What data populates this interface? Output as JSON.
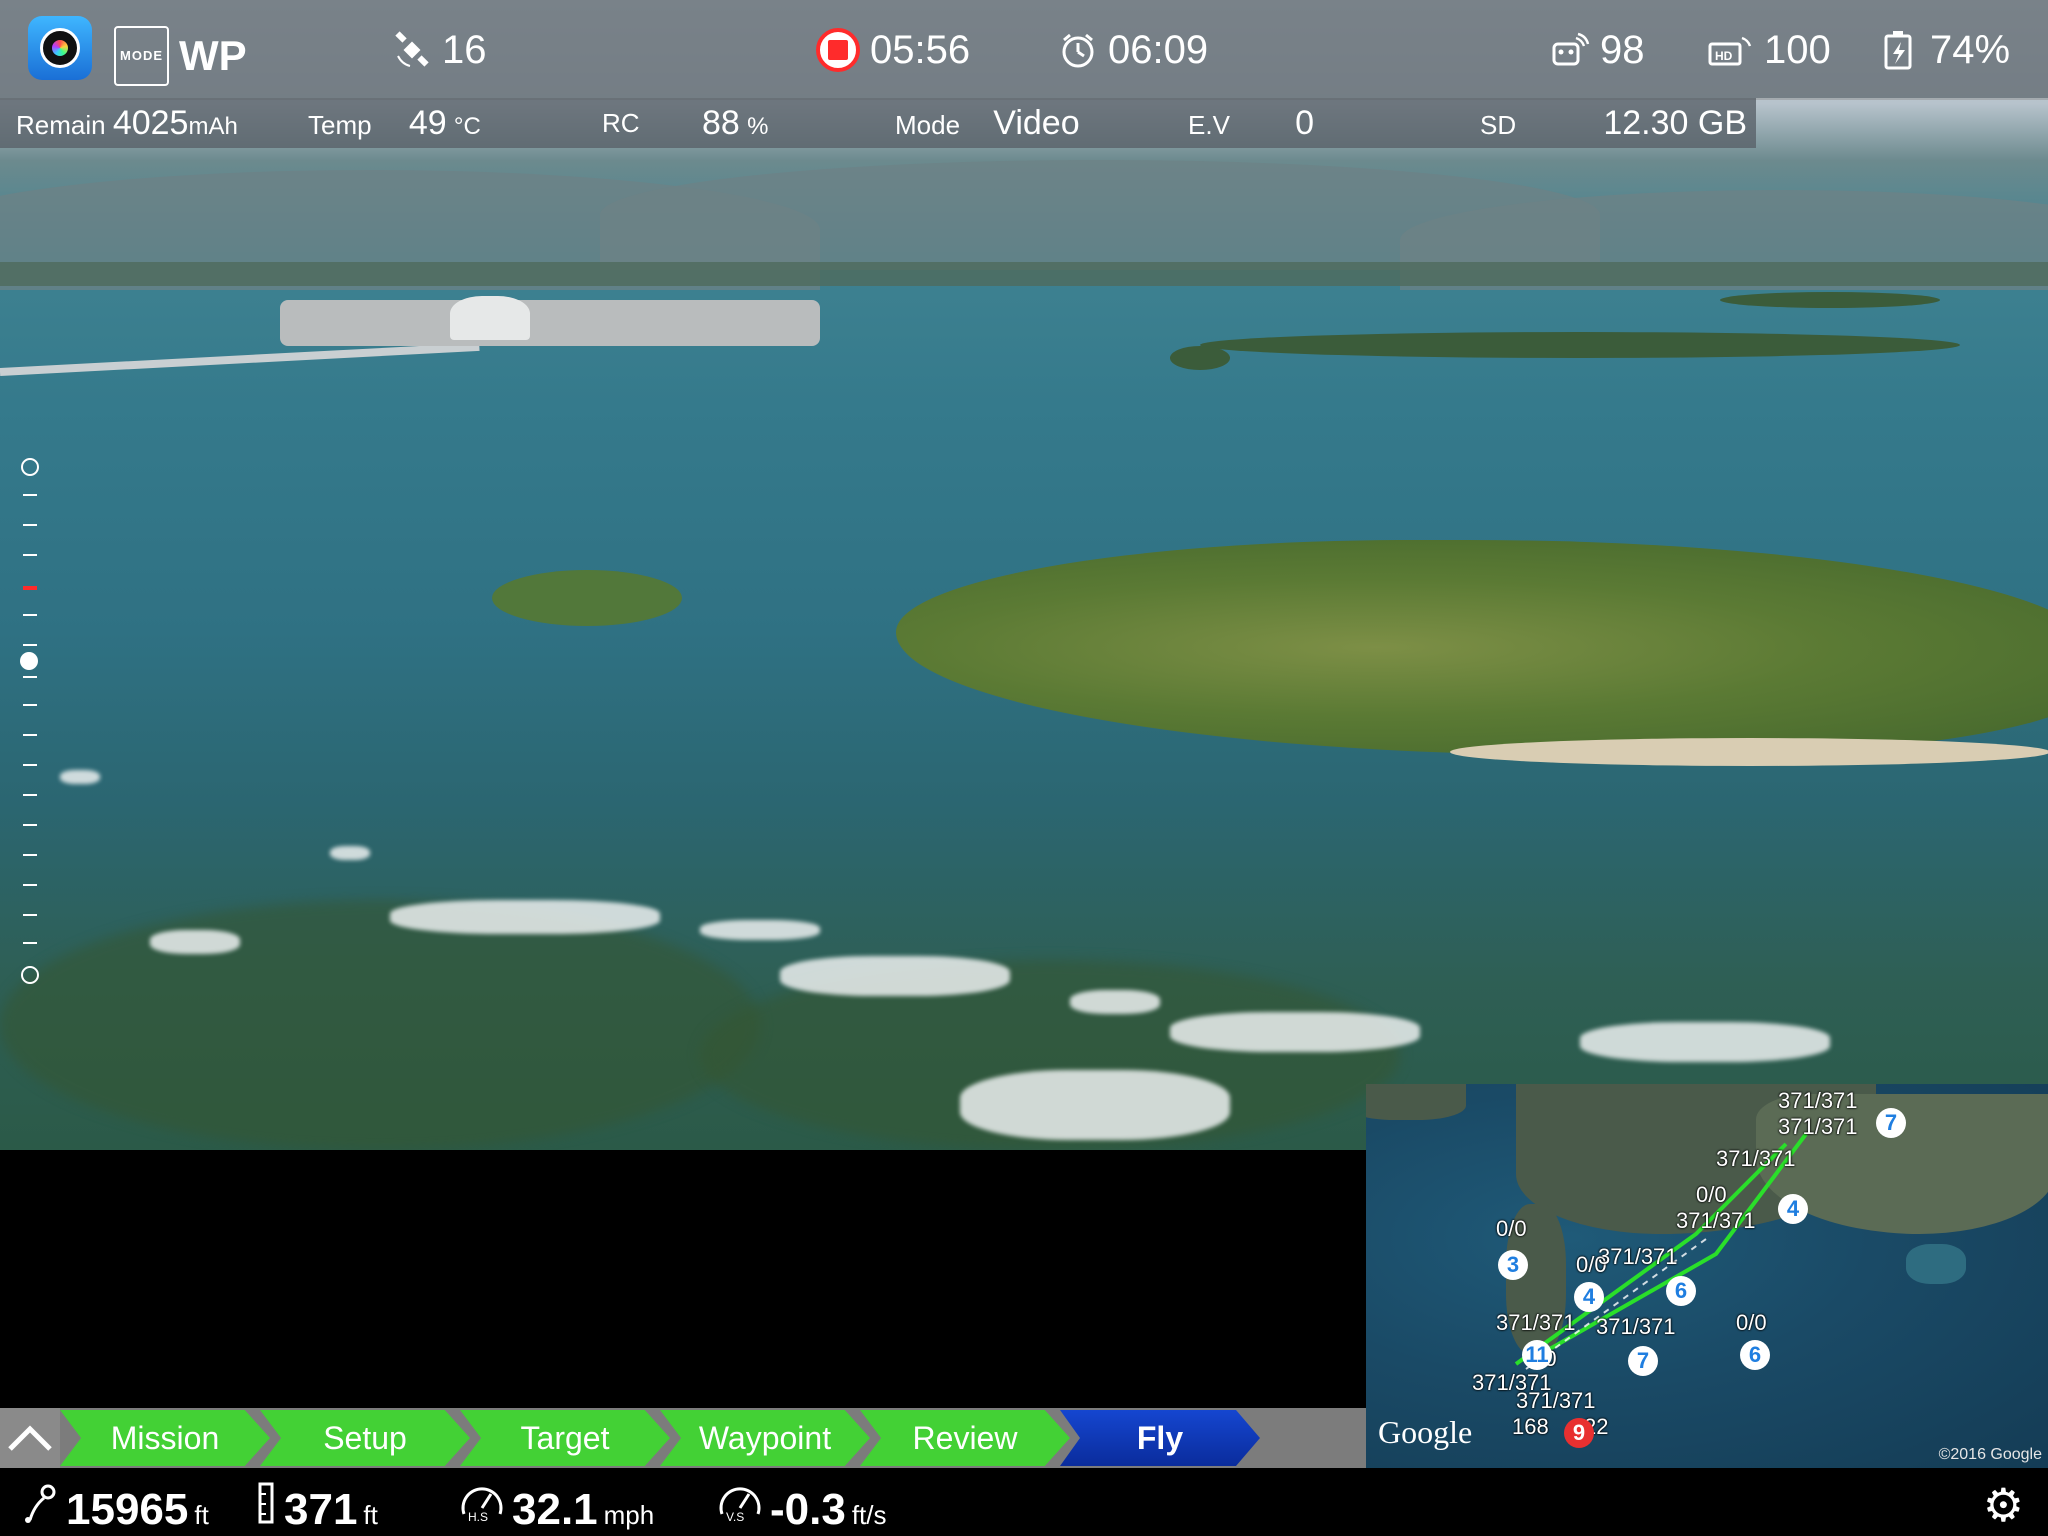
{
  "topbar": {
    "mode_badge": "MODE",
    "flight_mode": "WP",
    "satellites": "16",
    "recording_time": "05:56",
    "flight_timer": "06:09",
    "rc_signal": "98",
    "hd_signal": "100",
    "battery_percent": "74%"
  },
  "infobar": {
    "remain_label": "Remain",
    "remain_value": "4025",
    "remain_unit": "mAh",
    "temp_label": "Temp",
    "temp_value": "49",
    "temp_unit": "°C",
    "rc_label": "RC",
    "rc_value": "88",
    "rc_unit": "%",
    "mode_label": "Mode",
    "mode_value": "Video",
    "ev_label": "E.V",
    "ev_value": "0",
    "sd_label": "SD",
    "sd_value": "12.30 GB"
  },
  "map": {
    "brand": "Google",
    "copyright": "©2016 Google",
    "waypoint_numbers": [
      "3",
      "4",
      "6",
      "7",
      "11",
      "6",
      "4",
      "7",
      "9"
    ],
    "labels": [
      "371/371",
      "371/371",
      "371/371",
      "371/371",
      "0/0",
      "0/0",
      "0/0",
      "371/371",
      "371/371",
      "371/371",
      "0/0",
      "371/371",
      "371/371",
      "0/0",
      "168",
      "22"
    ]
  },
  "tabs": [
    {
      "label": "Mission",
      "state": "done"
    },
    {
      "label": "Setup",
      "state": "done"
    },
    {
      "label": "Target",
      "state": "done"
    },
    {
      "label": "Waypoint",
      "state": "done"
    },
    {
      "label": "Review",
      "state": "done"
    },
    {
      "label": "Fly",
      "state": "active"
    }
  ],
  "telemetry": {
    "distance_value": "15965",
    "distance_unit": "ft",
    "altitude_value": "371",
    "altitude_unit": "ft",
    "hs_label": "H.S",
    "hs_value": "32.1",
    "hs_unit": "mph",
    "vs_label": "V.S",
    "vs_value": "-0.3",
    "vs_unit": "ft/s"
  },
  "colors": {
    "tab_done": "#43d135",
    "tab_active": "#0a2c9c",
    "record": "#ff2b2b",
    "flight_path": "#2adf2a"
  },
  "icons": [
    "app-camera-icon",
    "satellite-icon",
    "record-icon",
    "timer-icon",
    "remote-controller-icon",
    "hd-signal-icon",
    "battery-icon",
    "chevron-up-icon",
    "distance-icon",
    "altitude-icon",
    "speed-gauge-icon",
    "settings-gear-icon"
  ]
}
